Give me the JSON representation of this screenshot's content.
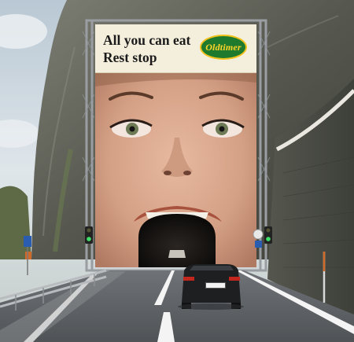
{
  "billboard": {
    "headline_line1": "All you can eat",
    "headline_line2": "Rest stop",
    "logo_text": "Oldtimer"
  },
  "colors": {
    "sky": "#cfd9e0",
    "rock": "#6b6d62",
    "skin": "#d9a98e",
    "road": "#5e6266",
    "logo_green": "#1f7a2e",
    "logo_yellow": "#ffd428"
  },
  "icons": [
    "traffic-light-icon",
    "road-sign-icon",
    "car-icon"
  ]
}
